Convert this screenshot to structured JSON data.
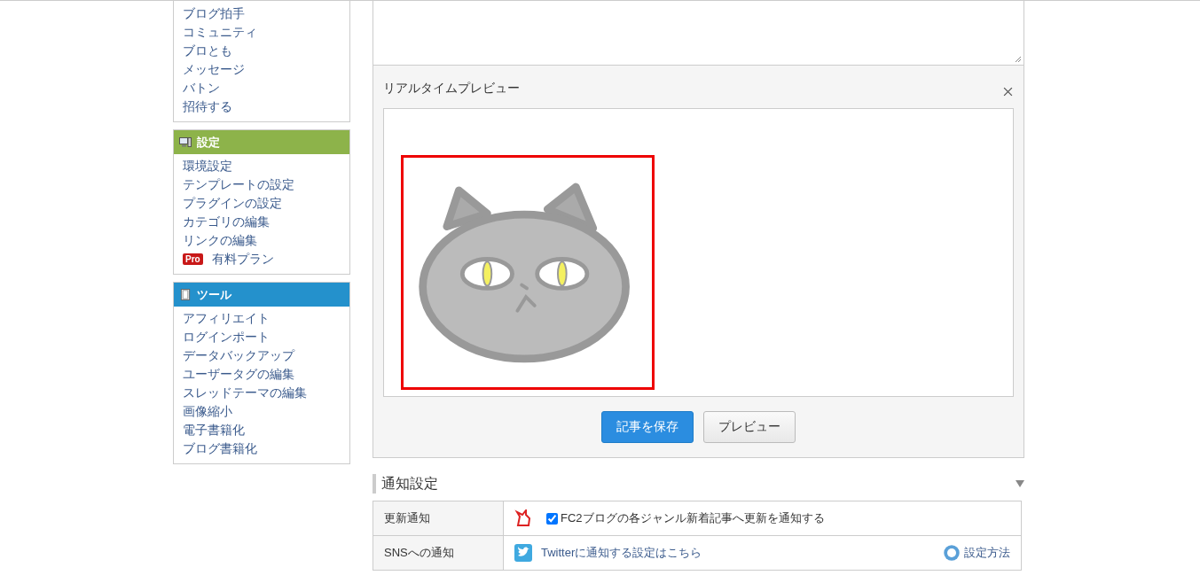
{
  "sidebar": {
    "groups": [
      {
        "items": [
          {
            "label": "ブログ拍手"
          },
          {
            "label": "コミュニティ"
          },
          {
            "label": "ブロとも"
          },
          {
            "label": "メッセージ"
          },
          {
            "label": "バトン"
          },
          {
            "label": "招待する"
          }
        ]
      },
      {
        "title": "設定",
        "items": [
          {
            "label": "環境設定"
          },
          {
            "label": "テンプレートの設定"
          },
          {
            "label": "プラグインの設定"
          },
          {
            "label": "カテゴリの編集"
          },
          {
            "label": "リンクの編集"
          },
          {
            "label": "有料プラン",
            "badge": "Pro"
          }
        ]
      },
      {
        "title": "ツール",
        "items": [
          {
            "label": "アフィリエイト"
          },
          {
            "label": "ログインポート"
          },
          {
            "label": "データバックアップ"
          },
          {
            "label": "ユーザータグの編集"
          },
          {
            "label": "スレッドテーマの編集"
          },
          {
            "label": "画像縮小"
          },
          {
            "label": "電子書籍化"
          },
          {
            "label": "ブログ書籍化"
          }
        ]
      }
    ]
  },
  "preview": {
    "title": "リアルタイムプレビュー"
  },
  "buttons": [
    {
      "label": "記事を保存",
      "kind": "primary"
    },
    {
      "label": "プレビュー",
      "kind": "secondary"
    }
  ],
  "notification": {
    "title": "通知設定",
    "rows": [
      {
        "label": "更新通知",
        "checkbox": {
          "checked": true,
          "label": "FC2ブログの各ジャンル新着記事へ更新を通知する"
        }
      },
      {
        "label": "SNSへの通知",
        "link": "Twitterに通知する設定はこちら",
        "help": "設定方法"
      }
    ]
  }
}
